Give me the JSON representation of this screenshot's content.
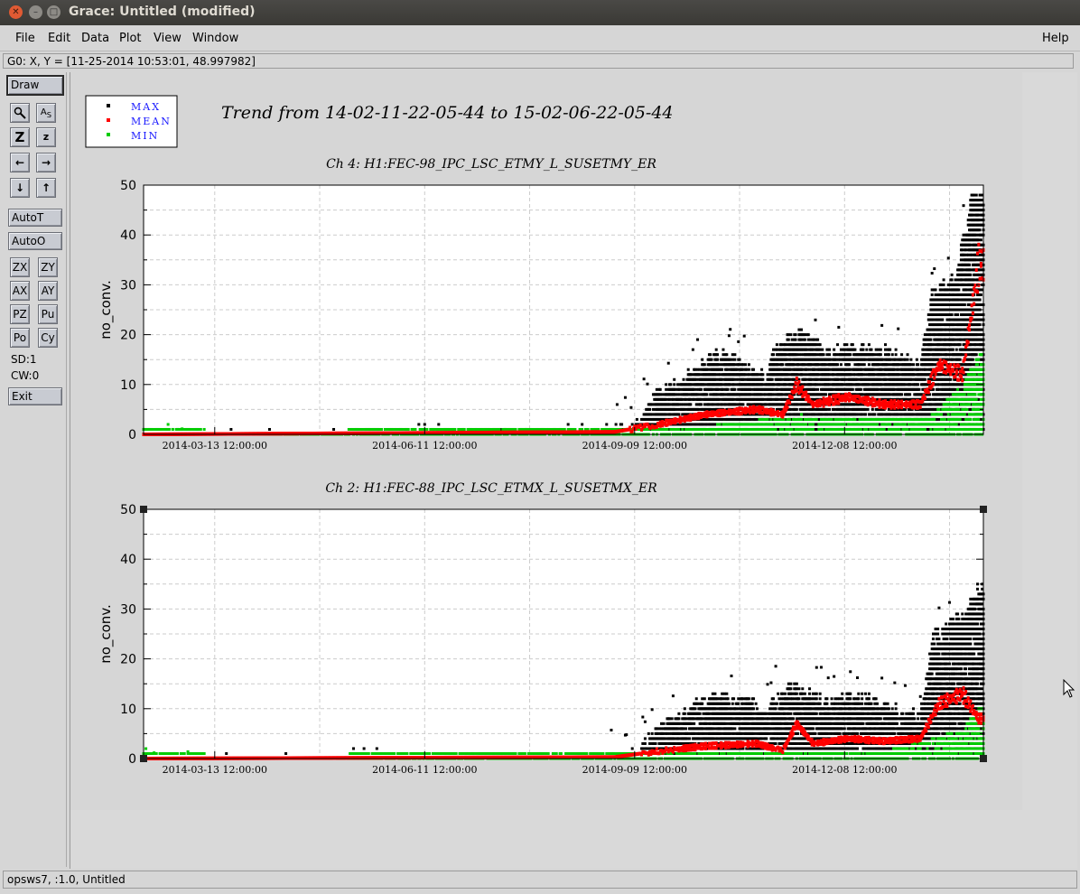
{
  "window": {
    "title": "Grace: Untitled (modified)"
  },
  "menu": {
    "file": "File",
    "edit": "Edit",
    "data": "Data",
    "plot": "Plot",
    "view": "View",
    "window": "Window",
    "help": "Help"
  },
  "locator": "G0: X, Y = [11-25-2014 10:53:01, 48.997982]",
  "toolbar": {
    "draw": "Draw",
    "autot": "AutoT",
    "autoo": "AutoO",
    "zx": "ZX",
    "zy": "ZY",
    "ax": "AX",
    "ay": "AY",
    "pz": "PZ",
    "pu": "Pu",
    "po": "Po",
    "cy": "Cy",
    "sd": "SD:1",
    "cw": "CW:0",
    "exit": "Exit"
  },
  "status": "opsws7, :1.0, Untitled",
  "plot": {
    "title": "Trend from 14-02-11-22-05-44 to 15-02-06-22-05-44",
    "legend": [
      {
        "name": "MAX",
        "color": "#000000"
      },
      {
        "name": "MEAN",
        "color": "#ff0000"
      },
      {
        "name": "MIN",
        "color": "#00cc00"
      }
    ]
  },
  "chart_data": [
    {
      "type": "scatter",
      "title": "Ch 4: H1:FEC-98_IPC_LSC_ETMY_L_SUSETMY_ER",
      "ylabel": "no_conv.",
      "ylim": [
        0,
        50
      ],
      "yticks": [
        0,
        10,
        20,
        30,
        40,
        50
      ],
      "xtick_labels": [
        "2014-03-13 12:00:00",
        "2014-06-11 12:00:00",
        "2014-09-09 12:00:00",
        "2014-12-08 12:00:00"
      ],
      "xrange": [
        "2014-02-11",
        "2015-02-06"
      ],
      "grid": true,
      "series": [
        {
          "name": "MAX",
          "color": "#000000",
          "points": [
            [
              "2014-03-01",
              1
            ],
            [
              "2014-04-20",
              1
            ],
            [
              "2014-06-01",
              2
            ],
            [
              "2014-07-15",
              1
            ],
            [
              "2014-08-20",
              2
            ],
            [
              "2014-09-08",
              3
            ],
            [
              "2014-09-20",
              10
            ],
            [
              "2014-10-05",
              14
            ],
            [
              "2014-10-15",
              18
            ],
            [
              "2014-10-25",
              16
            ],
            [
              "2014-11-05",
              13
            ],
            [
              "2014-11-10",
              20
            ],
            [
              "2014-11-20",
              22
            ],
            [
              "2014-12-01",
              18
            ],
            [
              "2014-12-15",
              19
            ],
            [
              "2014-12-30",
              18
            ],
            [
              "2015-01-10",
              15
            ],
            [
              "2015-01-15",
              30
            ],
            [
              "2015-01-25",
              33
            ],
            [
              "2015-02-01",
              49
            ]
          ]
        },
        {
          "name": "MEAN",
          "color": "#ff0000",
          "points": [
            [
              "2014-02-11",
              0
            ],
            [
              "2014-09-01",
              0.5
            ],
            [
              "2014-09-20",
              2
            ],
            [
              "2014-10-10",
              4
            ],
            [
              "2014-11-01",
              5
            ],
            [
              "2014-11-12",
              4
            ],
            [
              "2014-11-18",
              10
            ],
            [
              "2014-11-25",
              6
            ],
            [
              "2014-12-10",
              7.5
            ],
            [
              "2014-12-25",
              6
            ],
            [
              "2015-01-10",
              6
            ],
            [
              "2015-01-18",
              14
            ],
            [
              "2015-01-28",
              12
            ],
            [
              "2015-02-04",
              34
            ]
          ]
        },
        {
          "name": "MIN",
          "color": "#00cc00",
          "points": [
            [
              "2014-02-12",
              2
            ],
            [
              "2014-02-26",
              2
            ],
            [
              "2014-03-20",
              0
            ],
            [
              "2014-05-10",
              1
            ],
            [
              "2014-07-01",
              1
            ],
            [
              "2014-09-01",
              1
            ],
            [
              "2014-10-15",
              2
            ],
            [
              "2014-11-20",
              4
            ],
            [
              "2014-12-20",
              3
            ],
            [
              "2015-01-15",
              4
            ],
            [
              "2015-01-28",
              10
            ],
            [
              "2015-02-04",
              16
            ]
          ]
        }
      ]
    },
    {
      "type": "scatter",
      "title": "Ch 2: H1:FEC-88_IPC_LSC_ETMX_L_SUSETMX_ER",
      "ylabel": "no_conv.",
      "ylim": [
        0,
        50
      ],
      "yticks": [
        0,
        10,
        20,
        30,
        40,
        50
      ],
      "xtick_labels": [
        "2014-03-13 12:00:00",
        "2014-06-11 12:00:00",
        "2014-09-09 12:00:00",
        "2014-12-08 12:00:00"
      ],
      "xrange": [
        "2014-02-11",
        "2015-02-06"
      ],
      "grid": true,
      "series": [
        {
          "name": "MAX",
          "color": "#000000",
          "points": [
            [
              "2014-03-01",
              1
            ],
            [
              "2014-04-20",
              1
            ],
            [
              "2014-06-01",
              2
            ],
            [
              "2014-07-15",
              1
            ],
            [
              "2014-09-08",
              2
            ],
            [
              "2014-09-20",
              8
            ],
            [
              "2014-10-05",
              12
            ],
            [
              "2014-10-15",
              14
            ],
            [
              "2014-10-25",
              13
            ],
            [
              "2014-11-05",
              12
            ],
            [
              "2014-11-15",
              16
            ],
            [
              "2014-12-01",
              13
            ],
            [
              "2014-12-15",
              14
            ],
            [
              "2015-01-10",
              10
            ],
            [
              "2015-01-15",
              26
            ],
            [
              "2015-01-28",
              30
            ],
            [
              "2015-02-04",
              36
            ]
          ]
        },
        {
          "name": "MEAN",
          "color": "#ff0000",
          "points": [
            [
              "2014-02-11",
              0
            ],
            [
              "2014-09-01",
              0.3
            ],
            [
              "2014-09-20",
              1.5
            ],
            [
              "2014-10-10",
              2.5
            ],
            [
              "2014-11-01",
              3
            ],
            [
              "2014-11-12",
              1.5
            ],
            [
              "2014-11-18",
              7
            ],
            [
              "2014-11-25",
              3
            ],
            [
              "2014-12-10",
              4
            ],
            [
              "2014-12-25",
              3.5
            ],
            [
              "2015-01-10",
              4
            ],
            [
              "2015-01-18",
              11
            ],
            [
              "2015-01-28",
              13
            ],
            [
              "2015-02-04",
              8
            ]
          ]
        },
        {
          "name": "MIN",
          "color": "#00cc00",
          "points": [
            [
              "2014-02-12",
              2
            ],
            [
              "2014-02-26",
              2
            ],
            [
              "2014-03-20",
              0
            ],
            [
              "2014-05-10",
              1
            ],
            [
              "2014-07-01",
              1
            ],
            [
              "2014-09-01",
              1
            ],
            [
              "2014-10-15",
              1
            ],
            [
              "2014-11-20",
              1
            ],
            [
              "2014-12-20",
              1
            ],
            [
              "2015-01-15",
              4
            ],
            [
              "2015-01-28",
              6
            ],
            [
              "2015-02-04",
              10
            ]
          ]
        }
      ]
    }
  ]
}
